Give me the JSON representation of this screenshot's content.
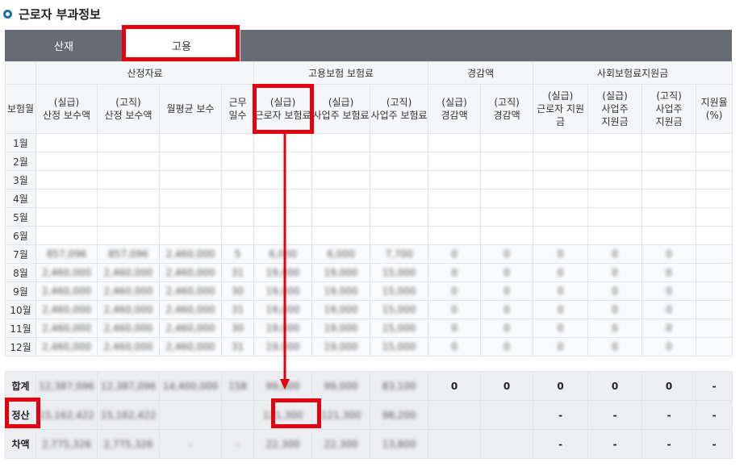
{
  "section": {
    "title": "근로자 부과정보"
  },
  "tabs": [
    {
      "label": "산재",
      "active": false
    },
    {
      "label": "고용",
      "active": true
    }
  ],
  "table": {
    "groups": {
      "calc": "산정자료",
      "premium": "고용보험 보험료",
      "reduction": "경감액",
      "support": "사회보험료지원금"
    },
    "headers": {
      "month": "보험월",
      "actual_pay": "(실급)\n산정 보수액",
      "assessed_pay": "(고직)\n산정 보수액",
      "avg_pay": "월평균 보수",
      "work_days": "근무\n일수",
      "worker_premium": "(실급)\n근로자 보험료",
      "employer_premium_actual": "(실급)\n사업주 보험료",
      "employer_premium_assessed": "(고직)\n사업주 보험료",
      "reduction_actual": "(실급)\n경감액",
      "reduction_assessed": "(고직)\n경감액",
      "support_worker": "(실급)\n근로자 지원금",
      "support_employer_actual": "(실급)\n사업주\n지원금",
      "support_employer_assessed": "(고직)\n사업주\n지원금",
      "support_rate": "지원율\n(%)"
    },
    "months": [
      {
        "label": "1월",
        "cells": [
          "",
          "",
          "",
          "",
          "",
          "",
          "",
          "",
          "",
          "",
          "",
          "",
          ""
        ]
      },
      {
        "label": "2월",
        "cells": [
          "",
          "",
          "",
          "",
          "",
          "",
          "",
          "",
          "",
          "",
          "",
          "",
          ""
        ]
      },
      {
        "label": "3월",
        "cells": [
          "",
          "",
          "",
          "",
          "",
          "",
          "",
          "",
          "",
          "",
          "",
          "",
          ""
        ]
      },
      {
        "label": "4월",
        "cells": [
          "",
          "",
          "",
          "",
          "",
          "",
          "",
          "",
          "",
          "",
          "",
          "",
          ""
        ]
      },
      {
        "label": "5월",
        "cells": [
          "",
          "",
          "",
          "",
          "",
          "",
          "",
          "",
          "",
          "",
          "",
          "",
          ""
        ]
      },
      {
        "label": "6월",
        "cells": [
          "",
          "",
          "",
          "",
          "",
          "",
          "",
          "",
          "",
          "",
          "",
          "",
          ""
        ]
      },
      {
        "label": "7월",
        "cells": [
          "857,096",
          "857,096",
          "2,460,000",
          "5",
          "6,000",
          "6,000",
          "7,700",
          "0",
          "0",
          "0",
          "0",
          "0",
          ""
        ]
      },
      {
        "label": "8월",
        "cells": [
          "2,460,000",
          "2,460,000",
          "2,460,000",
          "31",
          "19,000",
          "19,000",
          "15,000",
          "0",
          "0",
          "0",
          "0",
          "0",
          ""
        ]
      },
      {
        "label": "9월",
        "cells": [
          "2,460,000",
          "2,460,000",
          "2,460,000",
          "30",
          "19,000",
          "19,000",
          "15,000",
          "0",
          "0",
          "0",
          "0",
          "0",
          ""
        ]
      },
      {
        "label": "10월",
        "cells": [
          "2,460,000",
          "2,460,000",
          "2,460,000",
          "31",
          "19,000",
          "19,000",
          "15,000",
          "0",
          "0",
          "0",
          "0",
          "0",
          ""
        ]
      },
      {
        "label": "11월",
        "cells": [
          "2,460,000",
          "2,460,000",
          "2,460,000",
          "30",
          "19,000",
          "19,000",
          "15,000",
          "0",
          "0",
          "0",
          "0",
          "0",
          ""
        ]
      },
      {
        "label": "12월",
        "cells": [
          "2,460,000",
          "2,460,000",
          "2,460,000",
          "31",
          "19,000",
          "19,000",
          "15,000",
          "0",
          "0",
          "0",
          "0",
          "0",
          ""
        ]
      }
    ],
    "summary": [
      {
        "label": "합계",
        "cells": [
          "12,387,096",
          "12,387,096",
          "14,400,000",
          "158",
          "99,000",
          "99,000",
          "83,100",
          "0",
          "0",
          "0",
          "0",
          "0",
          "-"
        ]
      },
      {
        "label": "정산",
        "cells": [
          "15,162,422",
          "15,162,422",
          "",
          "",
          "121,300",
          "121,300",
          "98,200",
          "",
          "",
          "-",
          "-",
          "-",
          "-"
        ]
      },
      {
        "label": "차액",
        "cells": [
          "2,775,326",
          "2,775,326",
          "-",
          "-",
          "22,300",
          "22,300",
          "13,800",
          "",
          "",
          "-",
          "-",
          "-",
          "-"
        ]
      }
    ]
  },
  "colors": {
    "highlight": "#e3000f",
    "tab_bar": "#676b76",
    "header_bg": "#f5f6f8",
    "summary_bg": "#edeef2"
  }
}
